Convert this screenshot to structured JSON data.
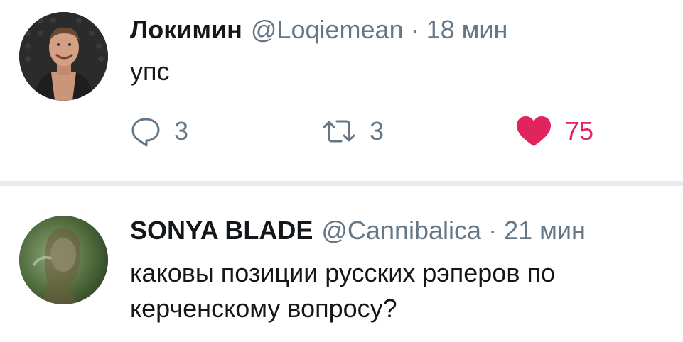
{
  "tweets": [
    {
      "name": "Локимин",
      "handle": "@Loqiemean",
      "separator": "·",
      "time": "18 мин",
      "text": "упс",
      "replies": "3",
      "retweets": "3",
      "likes": "75",
      "liked": true,
      "icons": {
        "reply": "reply-icon",
        "retweet": "retweet-icon",
        "like": "heart-icon"
      },
      "colors": {
        "liked": "#e0245e",
        "muted": "#657786"
      }
    },
    {
      "name": "SONYA BLADE",
      "handle": "@Cannibalica",
      "separator": "·",
      "time": "21 мин",
      "text": "каковы позиции русских рэперов по керченскому вопросу?"
    }
  ]
}
